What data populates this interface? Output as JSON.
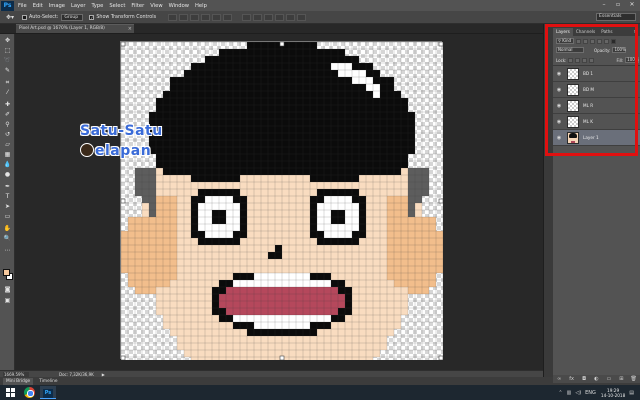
{
  "app": {
    "logo": "Ps",
    "menu": [
      "File",
      "Edit",
      "Image",
      "Layer",
      "Type",
      "Select",
      "Filter",
      "View",
      "Window",
      "Help"
    ],
    "window_controls": [
      "–",
      "▫",
      "✕"
    ]
  },
  "options_bar": {
    "auto_select_label": "Auto-Select:",
    "auto_select_value": "Group",
    "show_transform_label": "Show Transform Controls",
    "workspace": "Essentials"
  },
  "document_tab": {
    "title": "Pixel Art.psd @ 1670% (Layer 1, RGB/8)",
    "close": "×"
  },
  "watermark": {
    "line1": "Satu-Satu",
    "line2": "elapan"
  },
  "status": {
    "zoom": "1669.59%",
    "doc_size": "Doc: 7,32K/36,9K",
    "arrow": "▶"
  },
  "bottom_tabs": [
    "Mini Bridge",
    "Timeline"
  ],
  "layers_panel": {
    "tabs": [
      "Layers",
      "Channels",
      "Paths"
    ],
    "menu_icon": "≡",
    "filter_kind": "Kind",
    "blend_mode": "Normal",
    "opacity_label": "Opacity:",
    "opacity_value": "100%",
    "lock_label": "Lock:",
    "fill_label": "Fill:",
    "fill_value": "100%",
    "layers": [
      {
        "name": "BD 1",
        "thumb": "transparent",
        "selected": false
      },
      {
        "name": "BD M",
        "thumb": "transparent",
        "selected": false
      },
      {
        "name": "ML R",
        "thumb": "transparent",
        "selected": false
      },
      {
        "name": "ML K",
        "thumb": "transparent",
        "selected": false
      },
      {
        "name": "Layer 1",
        "thumb": "face",
        "selected": true
      }
    ],
    "bottom_icons": [
      "link-icon",
      "fx-icon",
      "mask-icon",
      "adjustment-icon",
      "folder-icon",
      "new-layer-icon",
      "trash-icon"
    ]
  },
  "tools": [
    "move-tool-icon",
    "marquee-tool-icon",
    "lasso-tool-icon",
    "quick-select-tool-icon",
    "crop-tool-icon",
    "eyedropper-tool-icon",
    "healing-brush-tool-icon",
    "brush-tool-icon",
    "clone-stamp-tool-icon",
    "history-brush-tool-icon",
    "eraser-tool-icon",
    "gradient-tool-icon",
    "blur-tool-icon",
    "dodge-tool-icon",
    "pen-tool-icon",
    "type-tool-icon",
    "path-select-tool-icon",
    "shape-tool-icon",
    "hand-tool-icon",
    "zoom-tool-icon"
  ],
  "colors": {
    "foreground": "#f7c99d",
    "background": "#ffffff",
    "highlight": "#e01010",
    "skin": "#f9dcc0",
    "skin_shadow": "#f2be8c",
    "hair": "#0b0b0b",
    "hair_side": "#5d5d5d",
    "mouth": "#b5485c"
  },
  "taskbar": {
    "time": "19:29",
    "date": "14-10-2018",
    "language": "ENG"
  }
}
